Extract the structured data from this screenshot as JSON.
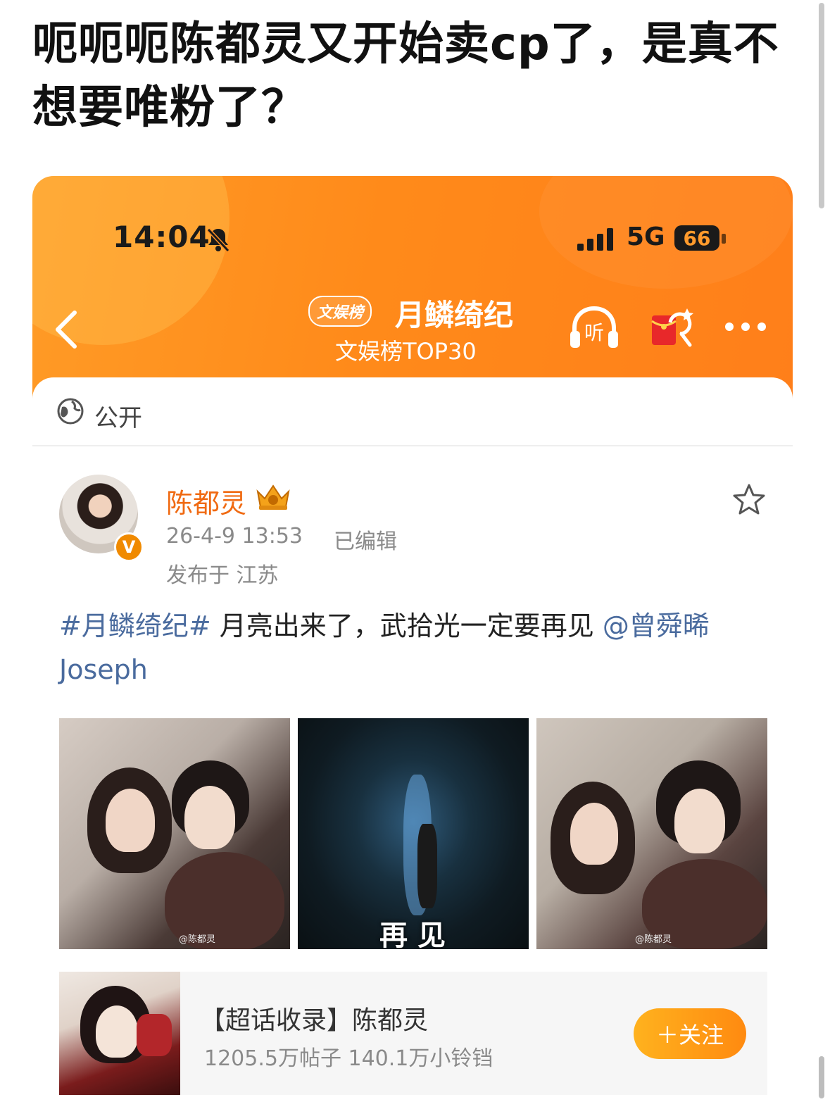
{
  "article": {
    "title": "呃呃呃陈都灵又开始卖cp了，是真不想要唯粉了？"
  },
  "status_bar": {
    "time": "14:04",
    "network": "5G",
    "battery": "66"
  },
  "header": {
    "tag": "文娱榜",
    "topic": "月鳞绮纪",
    "subtitle": "文娱榜TOP30",
    "listen_label": "听"
  },
  "visibility": {
    "label": "公开"
  },
  "post": {
    "author": "陈都灵",
    "verified_mark": "V",
    "time": "26-4-9 13:53",
    "edited": "已编辑",
    "location": "发布于 江苏",
    "hashtag": "#月鳞绮纪#",
    "text": " 月亮出来了，武拾光一定要再见 ",
    "mention": "@曾舜晞 Joseph",
    "images": [
      {
        "watermark": "@陈都灵"
      },
      {
        "caption": "再见"
      },
      {
        "watermark": "@陈都灵"
      }
    ]
  },
  "supertopic": {
    "title": "【超话收录】陈都灵",
    "stats": "1205.5万帖子 140.1万小铃铛",
    "follow_label": "＋关注"
  },
  "colors": {
    "header_orange": "#ff8a1a",
    "author_orange": "#f06a12",
    "link_blue": "#4a6b9e",
    "meta_gray": "#8a8a8a"
  }
}
